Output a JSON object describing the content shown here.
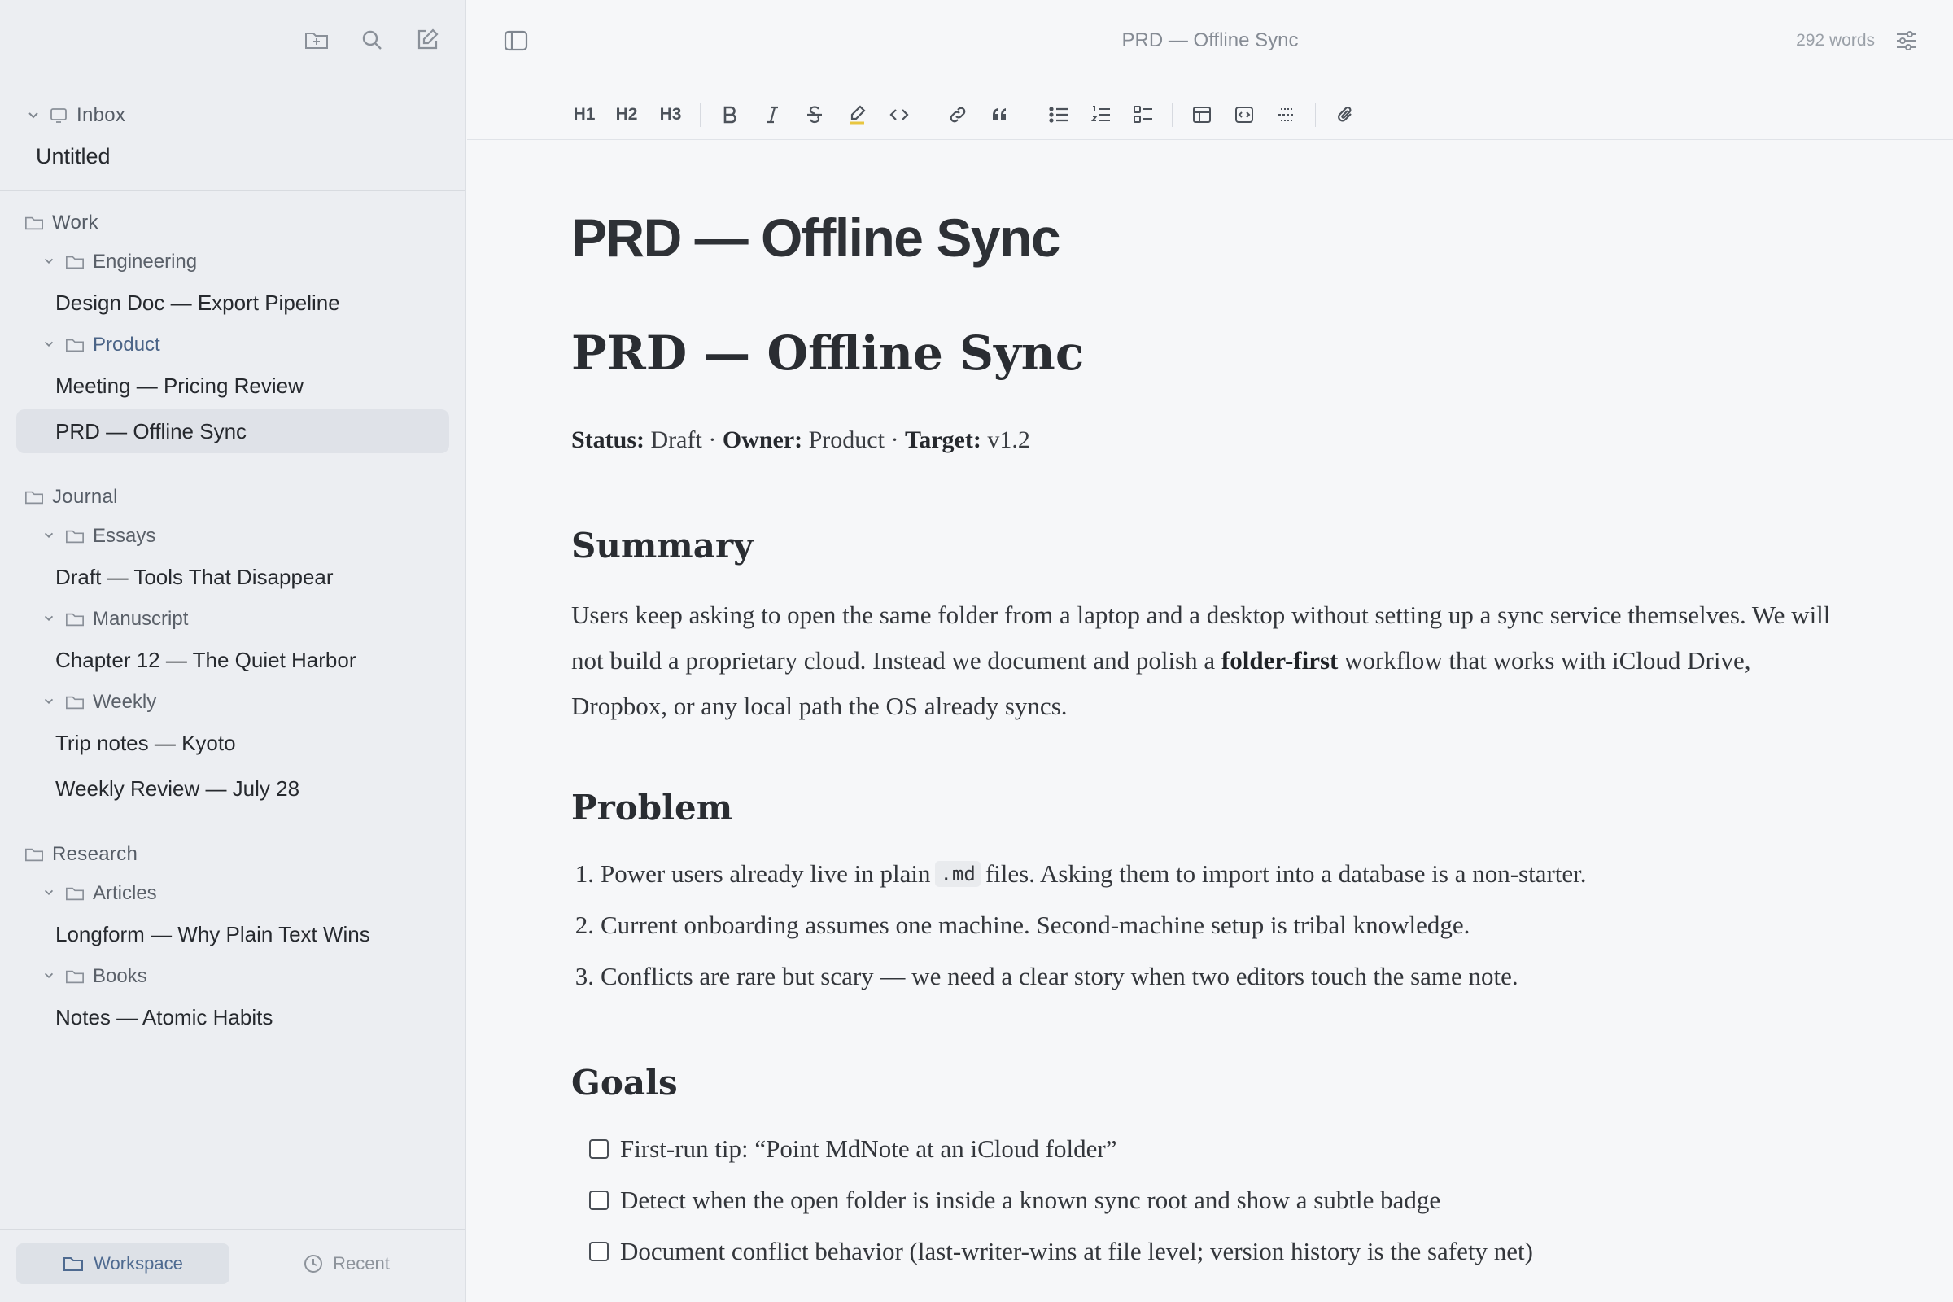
{
  "sidebar": {
    "inbox": {
      "label": "Inbox",
      "items": [
        "Untitled"
      ]
    },
    "sections": [
      {
        "label": "Work",
        "groups": [
          {
            "label": "Engineering",
            "items": [
              "Design Doc — Export Pipeline"
            ]
          },
          {
            "label": "Product",
            "items": [
              "Meeting — Pricing Review",
              "PRD — Offline Sync"
            ]
          }
        ]
      },
      {
        "label": "Journal",
        "groups": [
          {
            "label": "Essays",
            "items": [
              "Draft — Tools That Disappear"
            ]
          },
          {
            "label": "Manuscript",
            "items": [
              "Chapter 12 — The Quiet Harbor"
            ]
          },
          {
            "label": "Weekly",
            "items": [
              "Trip notes — Kyoto",
              "Weekly Review — July 28"
            ]
          }
        ]
      },
      {
        "label": "Research",
        "groups": [
          {
            "label": "Articles",
            "items": [
              "Longform — Why Plain Text Wins"
            ]
          },
          {
            "label": "Books",
            "items": [
              "Notes — Atomic Habits"
            ]
          }
        ]
      }
    ],
    "tabs": {
      "workspace": "Workspace",
      "recent": "Recent"
    }
  },
  "header": {
    "doc_title": "PRD — Offline Sync",
    "word_count": "292 words"
  },
  "toolbar": {
    "h1": "H1",
    "h2": "H2",
    "h3": "H3"
  },
  "document": {
    "title_sans": "PRD — Offline Sync",
    "title_serif": "PRD — Offline Sync",
    "meta": {
      "status_label": "Status:",
      "status_value": "Draft",
      "owner_label": "Owner:",
      "owner_value": "Product",
      "target_label": "Target:",
      "target_value": "v1.2",
      "sep": "·"
    },
    "summary": {
      "heading": "Summary",
      "text_1": "Users keep asking to open the same folder from a laptop and a desktop without setting up a sync service themselves. We will not build a proprietary cloud. Instead we document and polish a",
      "bold": "folder-first",
      "text_2": "workflow that works with iCloud Drive, Dropbox, or any local path the OS already syncs."
    },
    "problem": {
      "heading": "Problem",
      "items": [
        {
          "num": "1.",
          "before": "Power users already live in plain",
          "code": ".md",
          "after": "files. Asking them to import into a database is a non-starter."
        },
        {
          "num": "2.",
          "text": "Current onboarding assumes one machine. Second-machine setup is tribal knowledge."
        },
        {
          "num": "3.",
          "text": "Conflicts are rare but scary — we need a clear story when two editors touch the same note."
        }
      ]
    },
    "goals": {
      "heading": "Goals",
      "items": [
        "First-run tip: “Point MdNote at an iCloud folder”",
        "Detect when the open folder is inside a known sync root and show a subtle badge",
        "Document conflict behavior (last-writer-wins at file level; version history is the safety net)"
      ]
    }
  },
  "colors": {
    "sidebar_bg": "#eceef2",
    "selected_bg": "#dfe2e8",
    "accent": "#4e6a90",
    "main_bg": "#f6f7f9"
  }
}
